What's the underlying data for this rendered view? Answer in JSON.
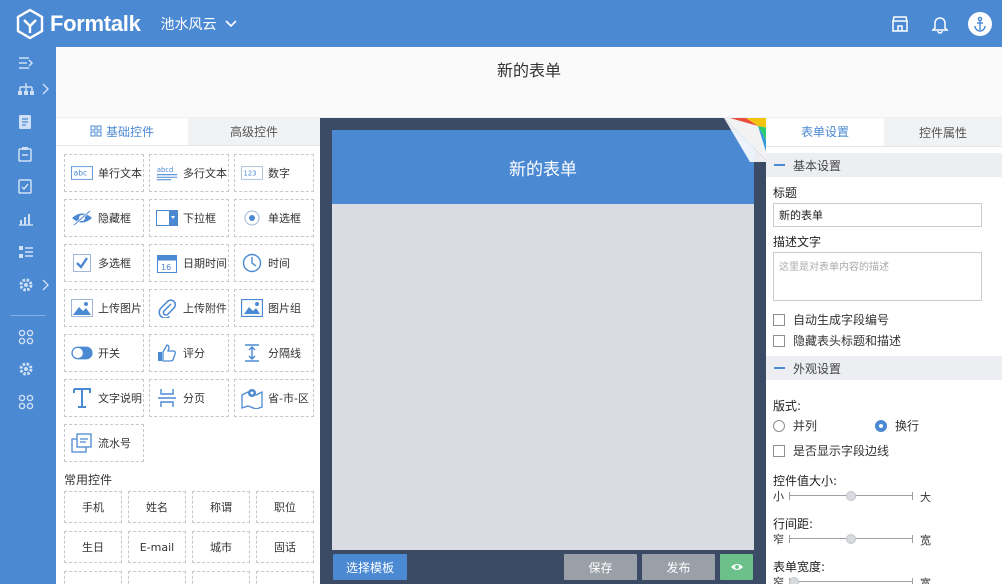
{
  "topbar": {
    "logo_text": "Formtalk",
    "workspace": "池水风云",
    "brand_color": "#4b89d3"
  },
  "leftnav": {
    "icons": [
      "collapse-icon",
      "org-icon",
      "doc-icon",
      "clipboard-icon",
      "check-icon",
      "chart-icon",
      "list-icon",
      "settings-icon",
      "apps-icon",
      "gear-icon",
      "apps2-icon"
    ]
  },
  "page": {
    "title": "新的表单"
  },
  "left_panel": {
    "tab_basic": "基础控件",
    "tab_advanced": "高级控件",
    "controls": [
      {
        "label": "单行文本",
        "icon": "abc-icon"
      },
      {
        "label": "多行文本",
        "icon": "abcd-icon"
      },
      {
        "label": "数字",
        "icon": "number-icon"
      },
      {
        "label": "隐藏框",
        "icon": "eye-off-icon"
      },
      {
        "label": "下拉框",
        "icon": "dropdown-icon"
      },
      {
        "label": "单选框",
        "icon": "radio-icon"
      },
      {
        "label": "多选框",
        "icon": "checkbox-icon"
      },
      {
        "label": "日期时间",
        "icon": "calendar-icon"
      },
      {
        "label": "时间",
        "icon": "clock-icon"
      },
      {
        "label": "上传图片",
        "icon": "image-icon"
      },
      {
        "label": "上传附件",
        "icon": "paperclip-icon"
      },
      {
        "label": "图片组",
        "icon": "gallery-icon"
      },
      {
        "label": "开关",
        "icon": "toggle-icon"
      },
      {
        "label": "评分",
        "icon": "thumbs-up-icon"
      },
      {
        "label": "分隔线",
        "icon": "divider-icon"
      },
      {
        "label": "文字说明",
        "icon": "text-icon"
      },
      {
        "label": "分页",
        "icon": "page-break-icon"
      },
      {
        "label": "省-市-区",
        "icon": "map-icon"
      },
      {
        "label": "流水号",
        "icon": "serial-icon"
      }
    ],
    "common_title": "常用控件",
    "common": [
      "手机",
      "姓名",
      "称谓",
      "职位",
      "生日",
      "E-mail",
      "城市",
      "固话"
    ],
    "calendar_number": "16",
    "number_icon_text": "123",
    "abc_text": "abc",
    "abcd_text": "abcd"
  },
  "canvas": {
    "form_title": "新的表单",
    "btn_template": "选择模板",
    "btn_save": "保存",
    "btn_publish": "发布"
  },
  "right_panel": {
    "tab_form": "表单设置",
    "tab_props": "控件属性",
    "section_basic": "基本设置",
    "label_title": "标题",
    "title_value": "新的表单",
    "label_desc": "描述文字",
    "desc_placeholder": "这里是对表单内容的描述",
    "check_auto": "自动生成字段编号",
    "check_hide": "隐藏表头标题和描述",
    "section_appearance": "外观设置",
    "label_layout": "版式:",
    "radio_inline": "并列",
    "radio_wrap": "换行",
    "check_border": "是否显示字段边线",
    "label_size": "控件值大小:",
    "size_min": "小",
    "size_max": "大",
    "size_level": 0.5,
    "label_spacing": "行间距:",
    "spacing_min": "窄",
    "spacing_max": "宽",
    "spacing_level": 0.5,
    "label_width": "表单宽度:",
    "width_min": "窄",
    "width_max": "宽",
    "width_level": 0.0
  }
}
